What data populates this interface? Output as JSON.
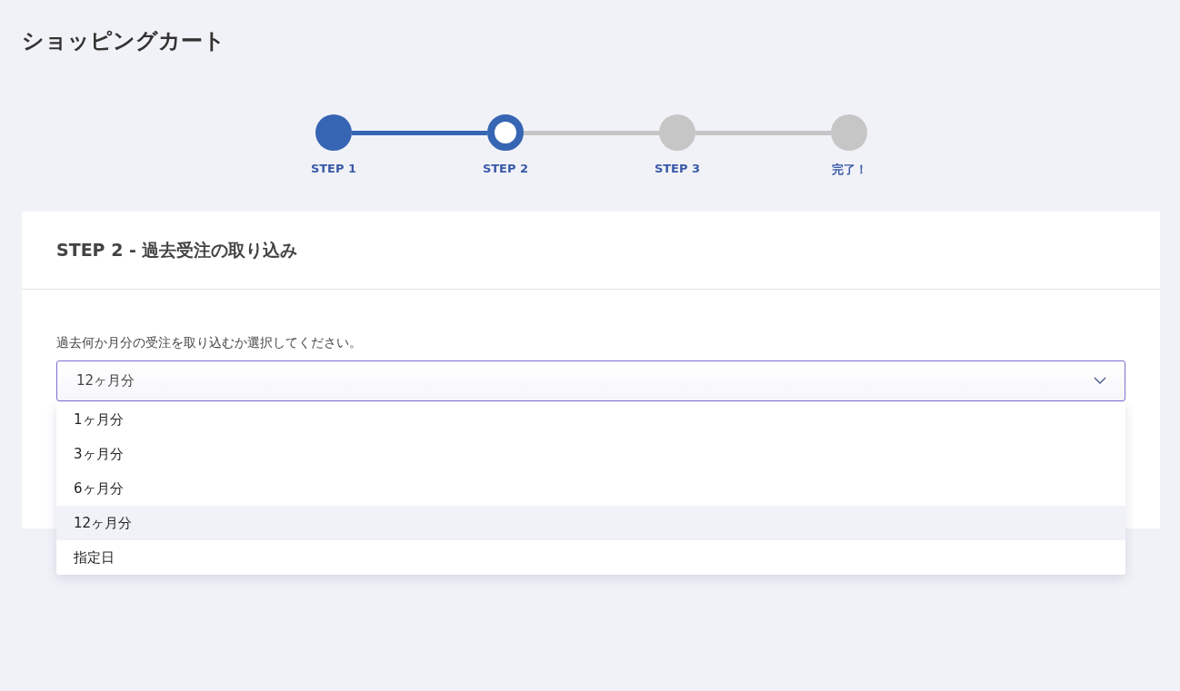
{
  "page": {
    "title": "ショッピングカート"
  },
  "steps": [
    {
      "label": "STEP 1",
      "completed": true,
      "selected": false
    },
    {
      "label": "STEP 2",
      "completed": false,
      "selected": true
    },
    {
      "label": "STEP 3",
      "completed": false,
      "selected": false
    },
    {
      "label": "完了！",
      "completed": false,
      "selected": false
    }
  ],
  "card": {
    "title": "STEP 2 - 過去受注の取り込み",
    "prompt": "過去何か月分の受注を取り込むか選択してください。",
    "select": {
      "value": "12ヶ月分",
      "expanded": true,
      "options": [
        {
          "label": "1ヶ月分",
          "selected": false
        },
        {
          "label": "3ヶ月分",
          "selected": false
        },
        {
          "label": "6ヶ月分",
          "selected": false
        },
        {
          "label": "12ヶ月分",
          "selected": true
        },
        {
          "label": "指定日",
          "selected": false
        }
      ]
    }
  }
}
